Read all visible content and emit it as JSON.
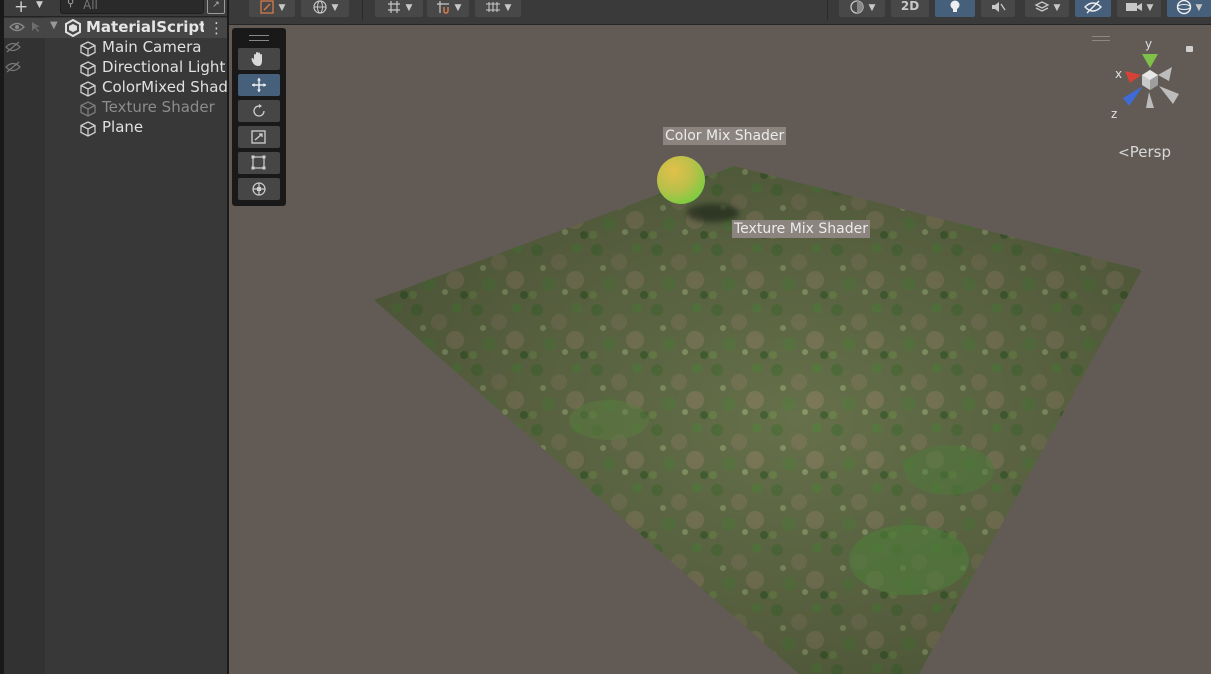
{
  "hierarchy": {
    "search": {
      "placeholder": "All"
    },
    "scene_name": "MaterialScriptir",
    "items": [
      {
        "label": "Main Camera"
      },
      {
        "label": "Directional Light"
      },
      {
        "label": "ColorMixed Shad"
      },
      {
        "label": "Texture Shader",
        "inactive": true
      },
      {
        "label": "Plane"
      }
    ]
  },
  "scene_toolbar": {
    "mode_2d": "2D"
  },
  "scene_view": {
    "persp_label": "Persp",
    "axis_labels": {
      "x": "x",
      "y": "y",
      "z": "z"
    },
    "labels": {
      "color_mix": "Color Mix Shader",
      "texture_mix": "Texture Mix Shader"
    }
  },
  "colors": {
    "panel_bg": "#383838",
    "scene_bg": "#625b55",
    "accent_active": "#46607c",
    "sphere_top": "#e2c04a",
    "sphere_bottom": "#62c63a"
  }
}
